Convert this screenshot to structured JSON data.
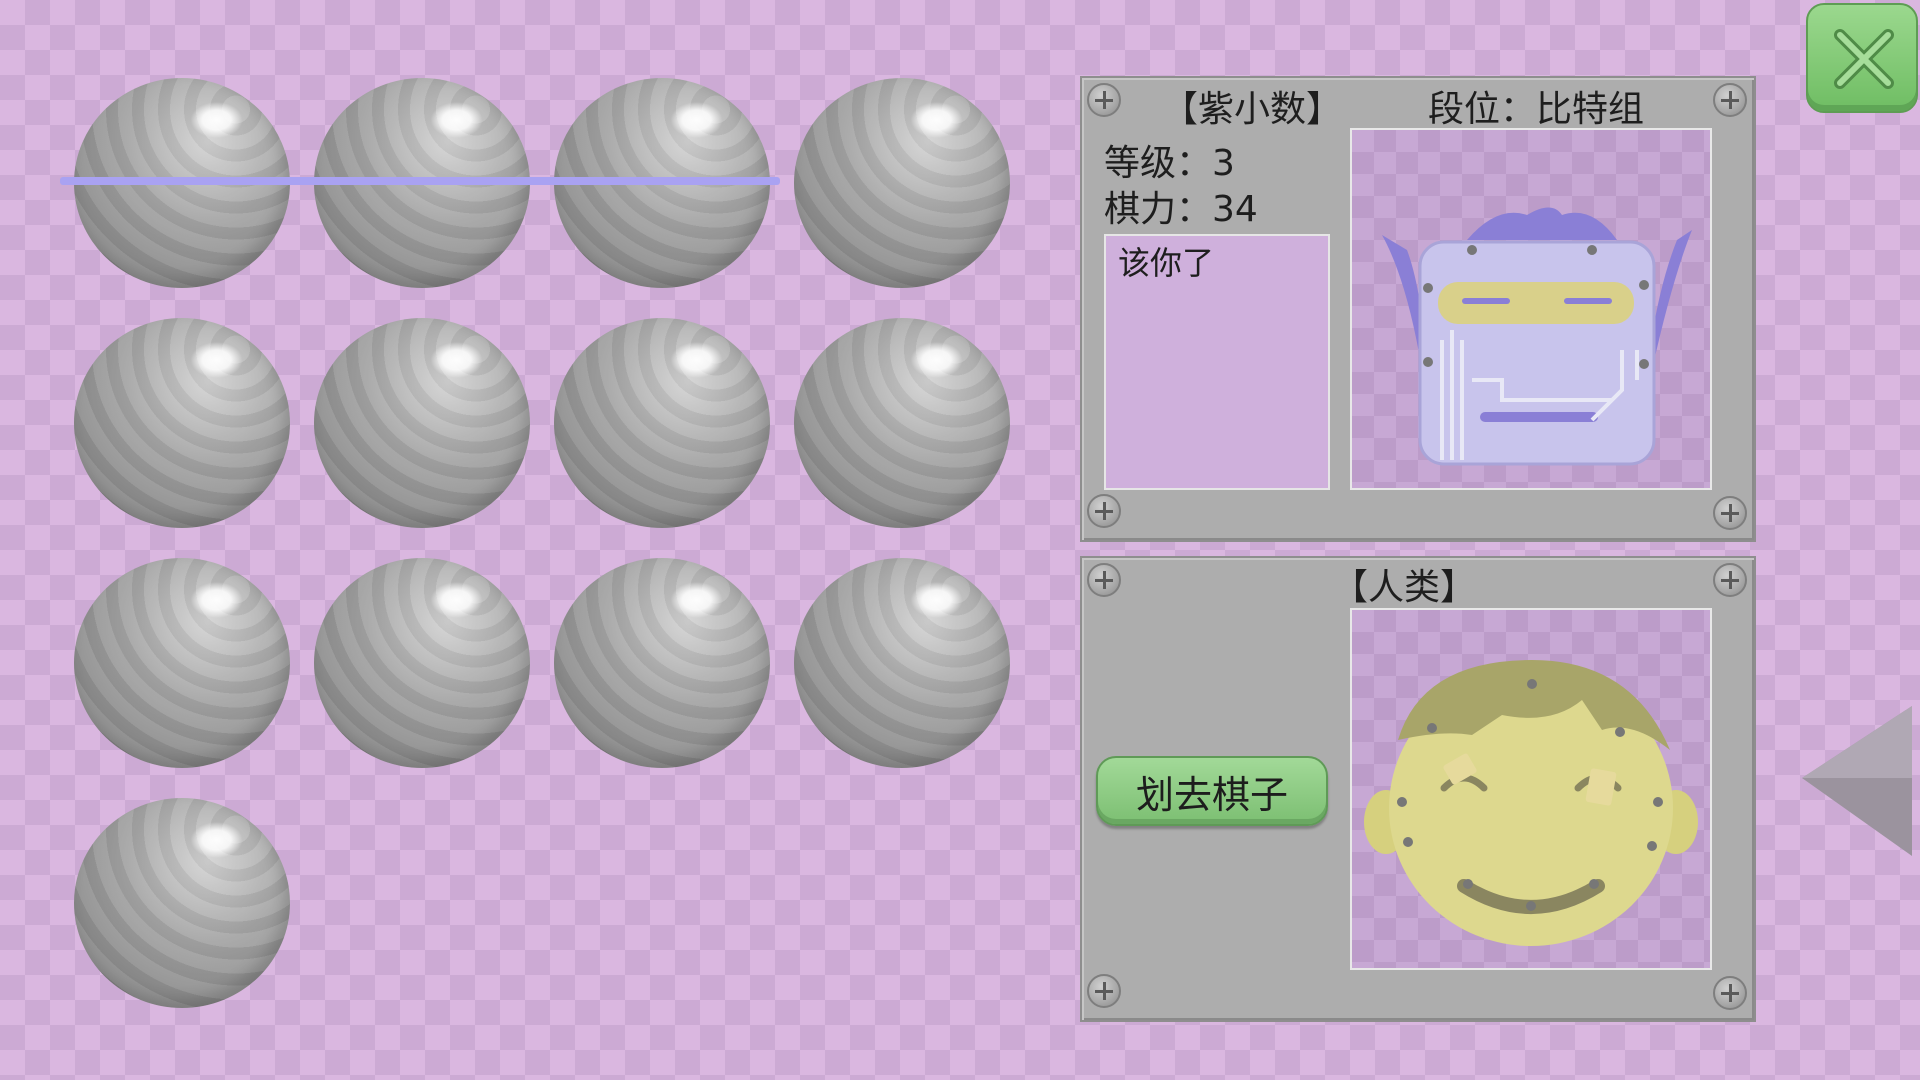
{
  "board": {
    "pieces": [
      {
        "row": 1,
        "col": 1,
        "struck": true
      },
      {
        "row": 1,
        "col": 2,
        "struck": true
      },
      {
        "row": 1,
        "col": 3,
        "struck": true
      },
      {
        "row": 1,
        "col": 4,
        "struck": false
      },
      {
        "row": 2,
        "col": 1,
        "struck": false
      },
      {
        "row": 2,
        "col": 2,
        "struck": false
      },
      {
        "row": 2,
        "col": 3,
        "struck": false
      },
      {
        "row": 2,
        "col": 4,
        "struck": false
      },
      {
        "row": 3,
        "col": 1,
        "struck": false
      },
      {
        "row": 3,
        "col": 2,
        "struck": false
      },
      {
        "row": 3,
        "col": 3,
        "struck": false
      },
      {
        "row": 3,
        "col": 4,
        "struck": false
      },
      {
        "row": 4,
        "col": 1,
        "struck": false
      }
    ],
    "strike_color": "#a9a2f2"
  },
  "opponent": {
    "name": "【紫小数】",
    "rank_label": "段位：比特组",
    "level_label": "等级：3",
    "power_label": "棋力：34",
    "message": "该你了",
    "avatar": "robot-face-icon"
  },
  "player": {
    "name": "【人类】",
    "action_button": "划去棋子",
    "avatar": "smiling-human-face-icon"
  },
  "controls": {
    "close_icon": "close-x-icon",
    "back_icon": "left-triangle-icon"
  },
  "colors": {
    "accent_green": "#7cbf72",
    "panel_gray": "#adadad",
    "background_purple": "#dab7e0"
  }
}
